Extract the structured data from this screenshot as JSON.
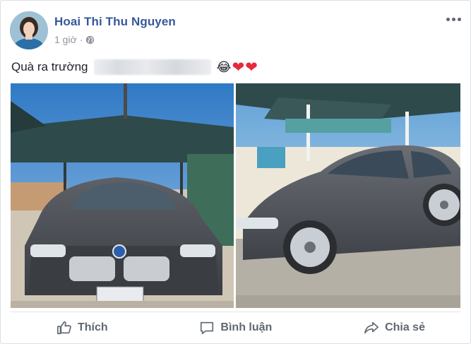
{
  "post": {
    "author": "Hoai Thi Thu Nguyen",
    "time": "1 giờ",
    "separator": "·",
    "text": "Quà ra trường",
    "emoji_smile": "😂",
    "emoji_heart": "❤"
  },
  "icons": {
    "privacy": "globe-icon",
    "more": "more-options-icon",
    "like": "thumbs-up-icon",
    "comment": "comment-icon",
    "share": "share-icon"
  },
  "actions": {
    "like_label": "Thích",
    "comment_label": "Bình luận",
    "share_label": "Chia sẻ"
  },
  "colors": {
    "author_link": "#365899",
    "meta_text": "#90949c",
    "action_text": "#606770"
  }
}
